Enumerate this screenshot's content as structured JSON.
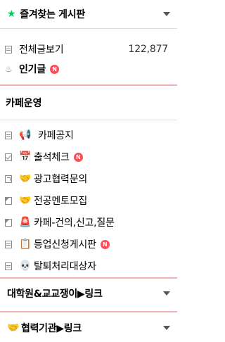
{
  "favorites": {
    "label": "즐겨찾는 게시판"
  },
  "all_posts": {
    "label": "전체글보기",
    "count": "122,877"
  },
  "popular": {
    "label": "인기글",
    "badge": "N"
  },
  "cafe_ops": {
    "title": "카페운영",
    "items": [
      {
        "icon": "megaphone-icon",
        "label": "카페공지"
      },
      {
        "icon": "calendar-icon",
        "label": "출석체크",
        "badge": "N"
      },
      {
        "icon": "handshake-icon",
        "label": "광고협력문의"
      },
      {
        "icon": "handshake-icon",
        "label": "전공멘토모집"
      },
      {
        "icon": "siren-icon",
        "label": "카페-건의,신고,질문"
      },
      {
        "icon": "clipboard-icon",
        "label": "등업신청게시판",
        "badge": "N"
      },
      {
        "icon": "skull-icon",
        "label": "탈퇴처리대상자"
      }
    ]
  },
  "grad_section": {
    "label": "대학원&교교쟁이▶링크"
  },
  "partner_section": {
    "label": "협력기관▶링크"
  }
}
